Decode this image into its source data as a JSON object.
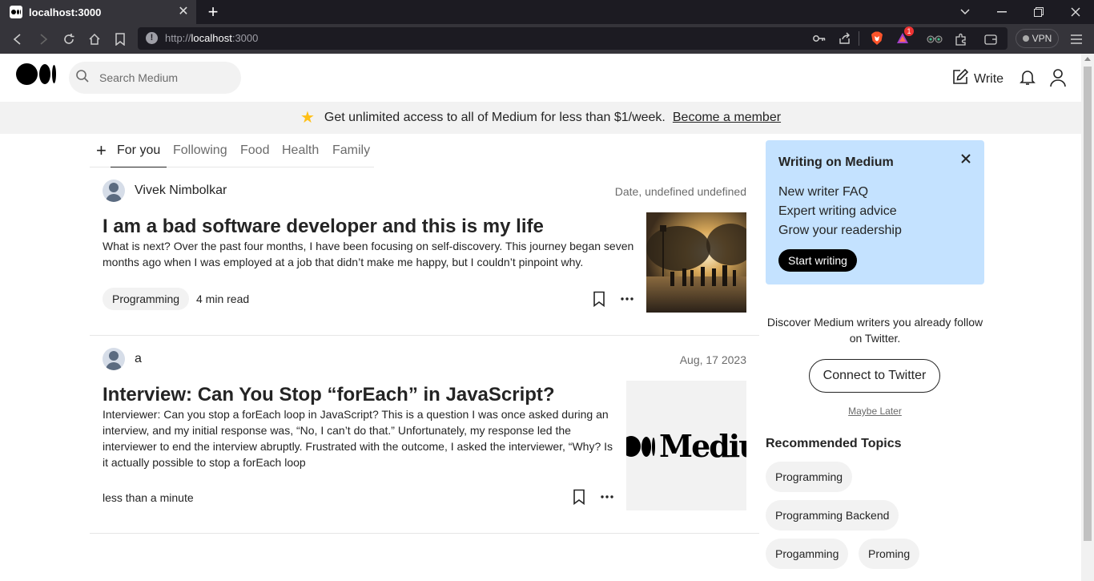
{
  "browser": {
    "tab_title": "localhost:3000",
    "url_scheme": "http://",
    "url_host": "localhost",
    "url_port": ":3000",
    "vpn_label": "VPN",
    "brave_badge": "1"
  },
  "header": {
    "search_placeholder": "Search Medium",
    "write_label": "Write"
  },
  "banner": {
    "text": "Get unlimited access to all of Medium for less than $1/week.",
    "link": "Become a member"
  },
  "tabs": {
    "items": [
      "For you",
      "Following",
      "Food",
      "Health",
      "Family"
    ],
    "active": "For you"
  },
  "articles": [
    {
      "author": "Vivek Nimbolkar",
      "date": "Date, undefined undefined",
      "title": "I am a bad software developer and this is my life",
      "excerpt": "What is next? Over the past four months, I have been focusing on self-discovery. This journey began seven months ago when I was employed at a job that didn’t make me happy, but I couldn’t pinpoint why.",
      "tag": "Programming",
      "read_time": "4 min read"
    },
    {
      "author": "a",
      "date": "Aug, 17 2023",
      "title": "Interview: Can You Stop “forEach” in JavaScript?",
      "excerpt": "Interviewer: Can you stop a forEach loop in JavaScript? This is a question I was once asked during an interview, and my initial response was, “No, I can’t do that.” Unfortunately, my response led the interviewer to end the interview abruptly. Frustrated with the outcome, I asked the interviewer, “Why? Is it actually possible to stop a forEach loop",
      "read_time": "less than a minute",
      "thumb_text": "Medium"
    }
  ],
  "sidebar": {
    "writing_card": {
      "title": "Writing on Medium",
      "links": [
        "New writer FAQ",
        "Expert writing advice",
        "Grow your readership"
      ],
      "button": "Start writing"
    },
    "twitter": {
      "text": "Discover Medium writers you already follow on Twitter.",
      "button": "Connect to Twitter",
      "dismiss": "Maybe Later"
    },
    "recommended": {
      "title": "Recommended Topics",
      "topics": [
        "Programming",
        "Programming Backend",
        "Progamming",
        "Proming"
      ]
    }
  }
}
